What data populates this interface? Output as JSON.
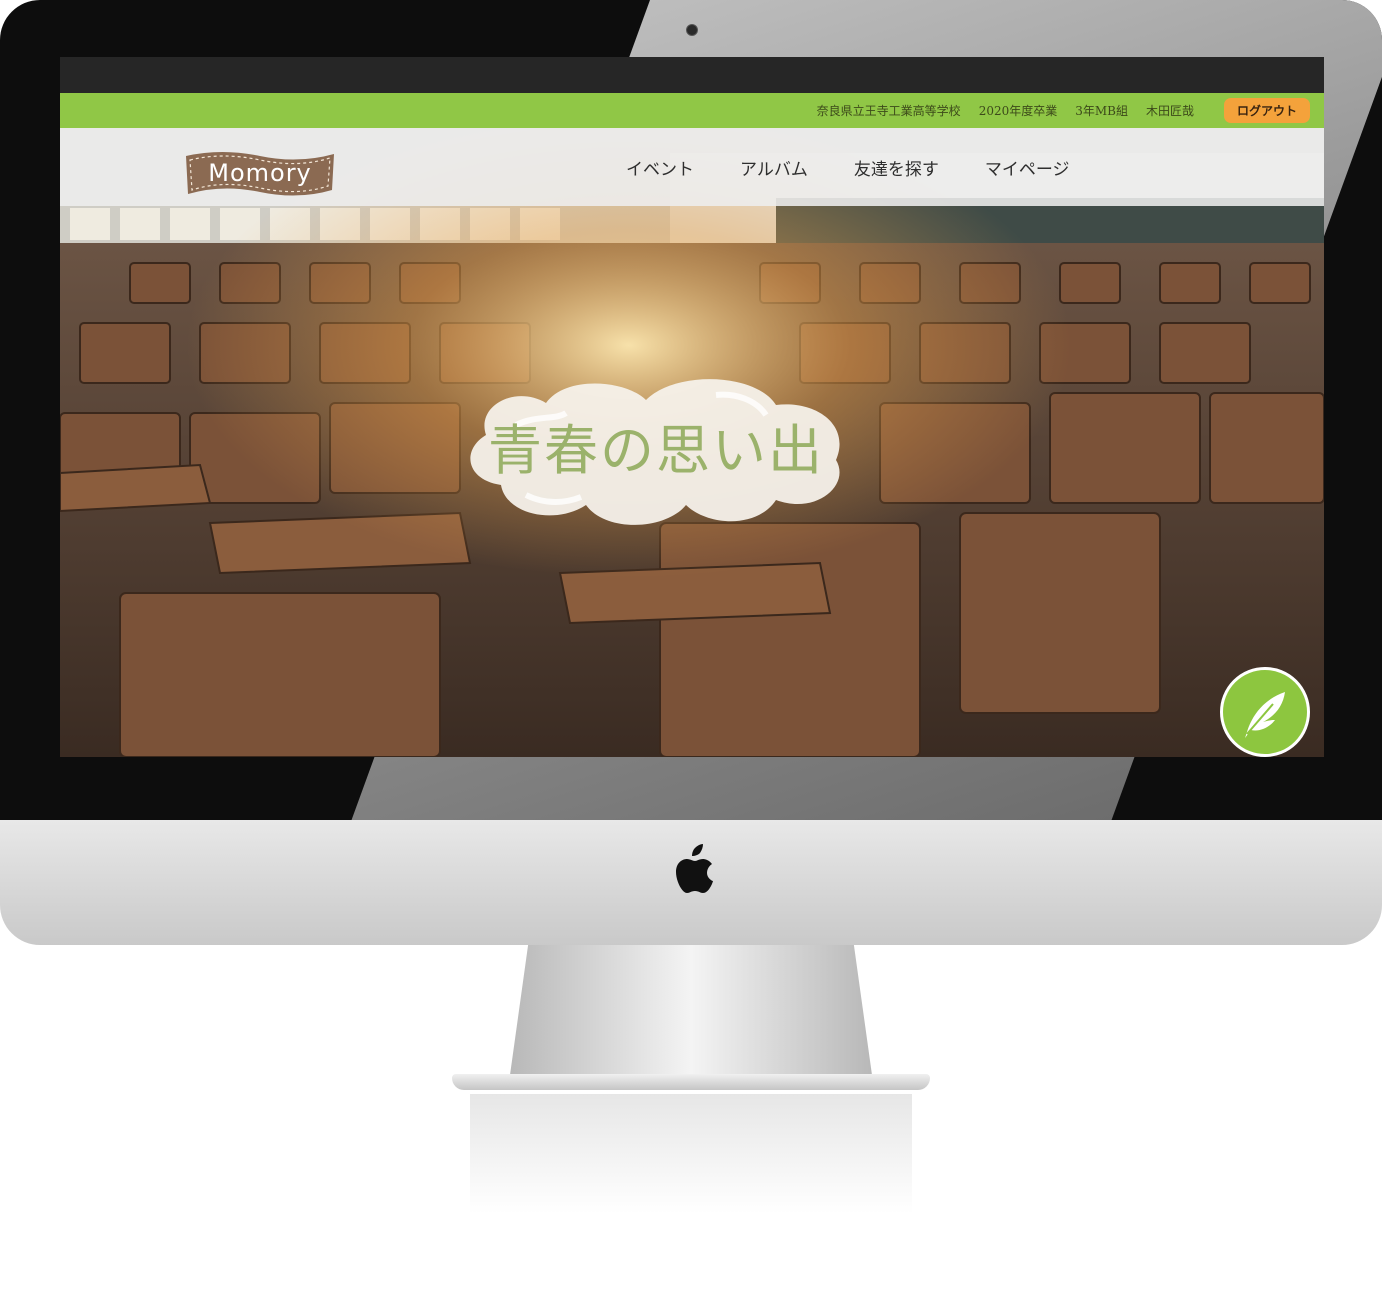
{
  "user_info": {
    "school": "奈良県立王寺工業高等学校",
    "graduation": "2020年度卒業",
    "class": "3年MB組",
    "name": "木田匠哉"
  },
  "logout_label": "ログアウト",
  "logo": {
    "text": "Momory"
  },
  "nav": [
    {
      "label": "イベント"
    },
    {
      "label": "アルバム"
    },
    {
      "label": "友達を探す"
    },
    {
      "label": "マイページ"
    }
  ],
  "hero": {
    "headline": "青春の思い出"
  },
  "icons": {
    "fab": "quill-icon",
    "device": "apple-logo-icon"
  },
  "colors": {
    "accent_green": "#8dc63f",
    "logout_orange": "#f4a23b",
    "logo_brown": "#8b6a52",
    "headline": "#9bb26b"
  }
}
